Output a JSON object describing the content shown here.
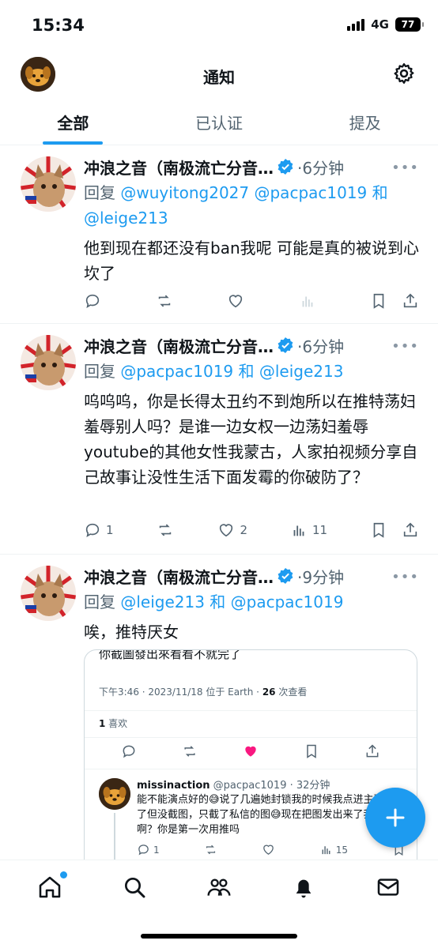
{
  "status_bar": {
    "time": "15:34",
    "network": "4G",
    "battery": "77"
  },
  "header": {
    "title": "通知"
  },
  "tabs": [
    {
      "label": "全部",
      "active": true
    },
    {
      "label": "已认证",
      "active": false
    },
    {
      "label": "提及",
      "active": false
    }
  ],
  "tweets": [
    {
      "name": "冲浪之音（南极流亡分音…",
      "time": "·6分钟",
      "reply_prefix": "回复",
      "reply_handles_html": "@wuyitong2027 @pacpac1019 和",
      "reply_handles_line2": "@leige213",
      "text": "他到现在都还没有ban我呢 可能是真的被说到心坎了",
      "reply_count": "",
      "like_count": "",
      "view_count": ""
    },
    {
      "name": "冲浪之音（南极流亡分音…",
      "time": "·6分钟",
      "reply_prefix": "回复",
      "reply_handles": "@pacpac1019 和 @leige213",
      "text": "呜呜呜，你是长得太丑约不到炮所以在推特荡妇羞辱别人吗？是谁一边女权一边荡妇羞辱youtube的其他女性我蒙古，人家拍视频分享自己故事让没性生活下面发霉的你破防了？",
      "reply_count": "1",
      "like_count": "2",
      "view_count": "11"
    },
    {
      "name": "冲浪之音（南极流亡分音…",
      "time": "·9分钟",
      "reply_prefix": "回复",
      "reply_handles": "@leige213 和 @pacpac1019",
      "text": "唉，推特厌女"
    }
  ],
  "embedded": {
    "cut_text": "你截圖發出來看看不就完了",
    "meta_time": "下午3:46 · 2023/11/18 位于 Earth · ",
    "meta_views_count": "26",
    "meta_views_label": " 次查看",
    "likes_count": "1",
    "likes_label": " 喜欢",
    "reply_name": "missinaction",
    "reply_handle_time": " @pacpac1019 · 32分钟",
    "reply_text": "能不能演点好的😅说了几遍她封锁我的时候我点进主页看到了但没截图，只截了私信的图😅现在把图发出来了我截什么啊？你是第一次用推吗",
    "reply_comments": "1",
    "reply_views": "15"
  },
  "colors": {
    "accent": "#1d9bf0",
    "like_pink": "#f91880",
    "muted": "#536471"
  }
}
